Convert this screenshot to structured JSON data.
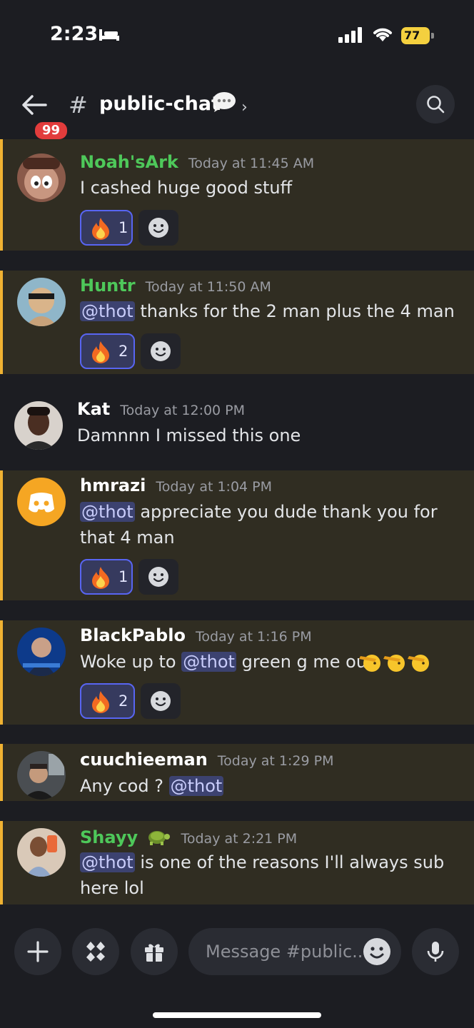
{
  "status": {
    "time": "2:23",
    "battery": "77"
  },
  "header": {
    "unread_badge": "99",
    "hash": "#",
    "channel": "public-chat",
    "chevron": "›"
  },
  "messages": [
    {
      "author": "Noah'sArk",
      "time": "Today at 11:45 AM",
      "text": "I cashed huge good stuff",
      "reaction_count": "1"
    },
    {
      "author": "Huntr",
      "time": "Today at 11:50 AM",
      "mention": "@thot",
      "text": " thanks for the 2 man plus the 4 man",
      "reaction_count": "2"
    },
    {
      "author": "Kat",
      "time": "Today at 12:00 PM",
      "text": "Damnnn I missed this one"
    },
    {
      "author": "hmrazi",
      "time": "Today at 1:04 PM",
      "mention": "@thot",
      "text": " appreciate you dude thank you for that 4 man",
      "reaction_count": "1"
    },
    {
      "author": "BlackPablo",
      "time": "Today at 1:16 PM",
      "text_before": "Woke up to ",
      "mention": "@thot",
      "text": " green g me out",
      "reaction_count": "2"
    },
    {
      "author": "cuuchieeman",
      "time": "Today at 1:29 PM",
      "text_before": "Any cod ? ",
      "mention": "@thot"
    },
    {
      "author": "Shayy",
      "time": "Today at 2:21 PM",
      "mention": "@thot",
      "text": " is one of the reasons I'll always sub here lol"
    }
  ],
  "composer": {
    "placeholder": "Message #public..."
  },
  "colors": {
    "accent": "#5865f2",
    "highlight_bar": "#f0b232",
    "green_name": "#4ec85a"
  }
}
